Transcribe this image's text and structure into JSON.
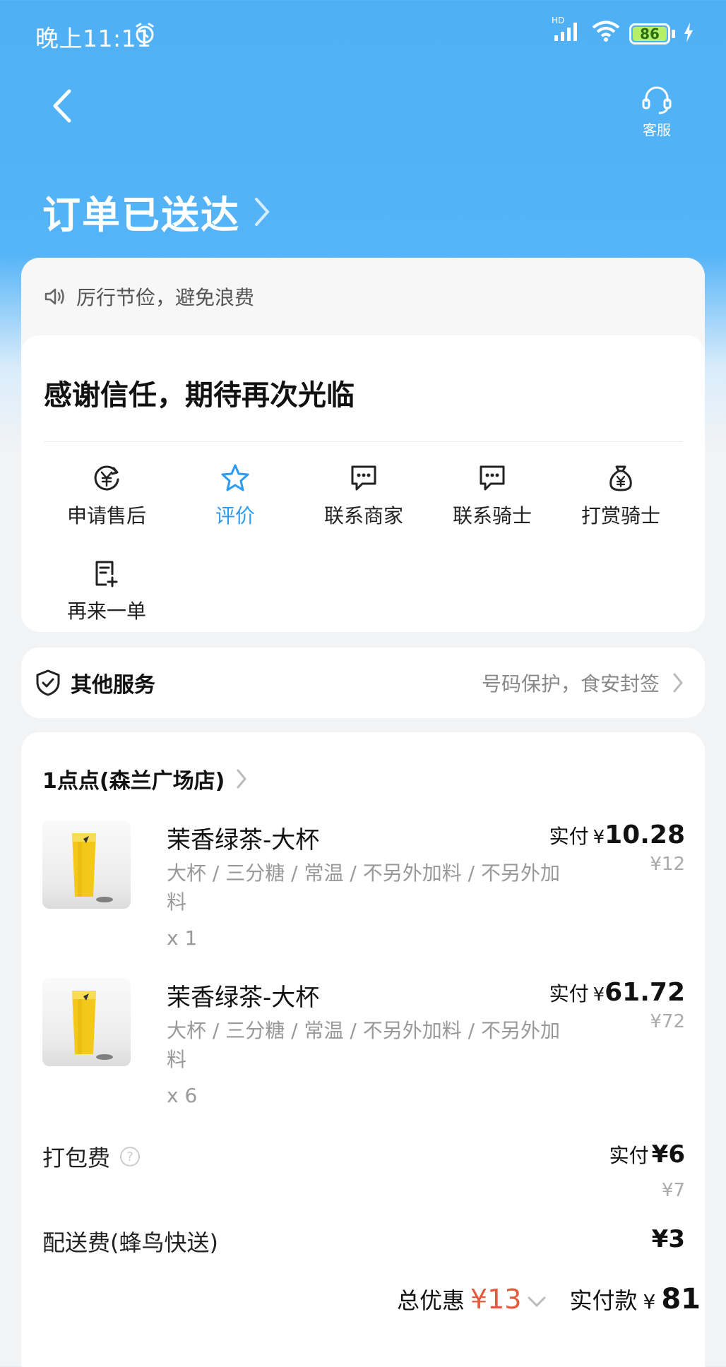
{
  "status_bar": {
    "time": "晚上11:11",
    "signal_label": "HD",
    "battery": "86"
  },
  "header": {
    "service_label": "客服",
    "order_status": "订单已送达"
  },
  "notice": {
    "text": "厉行节俭，避免浪费"
  },
  "thanks": {
    "title": "感谢信任，期待再次光临",
    "actions": [
      {
        "label": "申请售后",
        "icon": "refund-icon"
      },
      {
        "label": "评价",
        "icon": "star-icon"
      },
      {
        "label": "联系商家",
        "icon": "chat-icon"
      },
      {
        "label": "联系骑士",
        "icon": "chat-icon"
      },
      {
        "label": "打赏骑士",
        "icon": "money-bag-icon"
      },
      {
        "label": "再来一单",
        "icon": "reorder-icon"
      }
    ]
  },
  "services": {
    "title": "其他服务",
    "desc": "号码保护，食安封签"
  },
  "order": {
    "store": "1点点(森兰广场店)",
    "items": [
      {
        "name": "茉香绿茶-大杯",
        "spec": "大杯 / 三分糖 / 常温 / 不另外加料 / 不另外加料",
        "qty": "x 1",
        "paid_label": "实付",
        "currency": "¥",
        "paid": "10.28",
        "original": "¥12"
      },
      {
        "name": "茉香绿茶-大杯",
        "spec": "大杯 / 三分糖 / 常温 / 不另外加料 / 不另外加料",
        "qty": "x 6",
        "paid_label": "实付",
        "currency": "¥",
        "paid": "61.72",
        "original": "¥72"
      }
    ],
    "packing": {
      "label": "打包费",
      "paid_label": "实付",
      "paid": "¥6",
      "original": "¥7"
    },
    "delivery": {
      "label": "配送费(蜂鸟快送)",
      "value": "¥3"
    },
    "total": {
      "discount_label": "总优惠",
      "discount": "¥13",
      "paid_label": "实付款",
      "currency": "¥",
      "paid": "81"
    }
  },
  "colors": {
    "accent": "#2d9cf0",
    "discount": "#e55a3c",
    "header_bg": "#4fb0f5"
  }
}
